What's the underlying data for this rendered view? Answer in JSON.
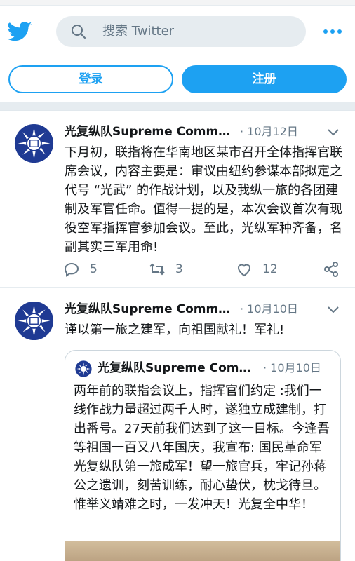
{
  "search": {
    "placeholder": "搜索 Twitter"
  },
  "buttons": {
    "login": "登录",
    "signup": "注册"
  },
  "tweets": [
    {
      "author": "光复纵队Supreme Comm…",
      "date": "· 10月12日",
      "text": "下月初，联指将在华南地区某市召开全体指挥官联席会议，内容主要是：审议由纽约参谋本部拟定之代号 “光武” 的作战计划，以及我纵一旅的各团建制及军官任命。值得一提的是，本次会议首次有现役空军指挥官参加会议。至此，光纵军种齐备，名副其实三军用命!",
      "replies": "5",
      "retweets": "3",
      "likes": "12"
    },
    {
      "author": "光复纵队Supreme Comm…",
      "date": "· 10月10日",
      "text": "谨以第一旅之建军，向祖国献礼！军礼!",
      "quote": {
        "author": "光复纵队Supreme Com…",
        "date": "· 10月10日",
        "text": "两年前的联指会议上，指挥官们约定 :我们一线作战力量超过两千人时，遂独立成建制，打出番号。27天前我们达到了这一目标。今逢吾等祖国一百又八年国庆，我宣布: 国民革命军光复纵队第一旅成军！望一旅官兵，牢记孙蒋公之遗训，刻苦训练，耐心蛰伏，枕戈待旦。惟举义靖难之时，一发冲天！光复全中华！"
      }
    }
  ],
  "colors": {
    "accent": "#1da1f2",
    "muted": "#657786",
    "emblem_blue": "#1f3a93"
  }
}
